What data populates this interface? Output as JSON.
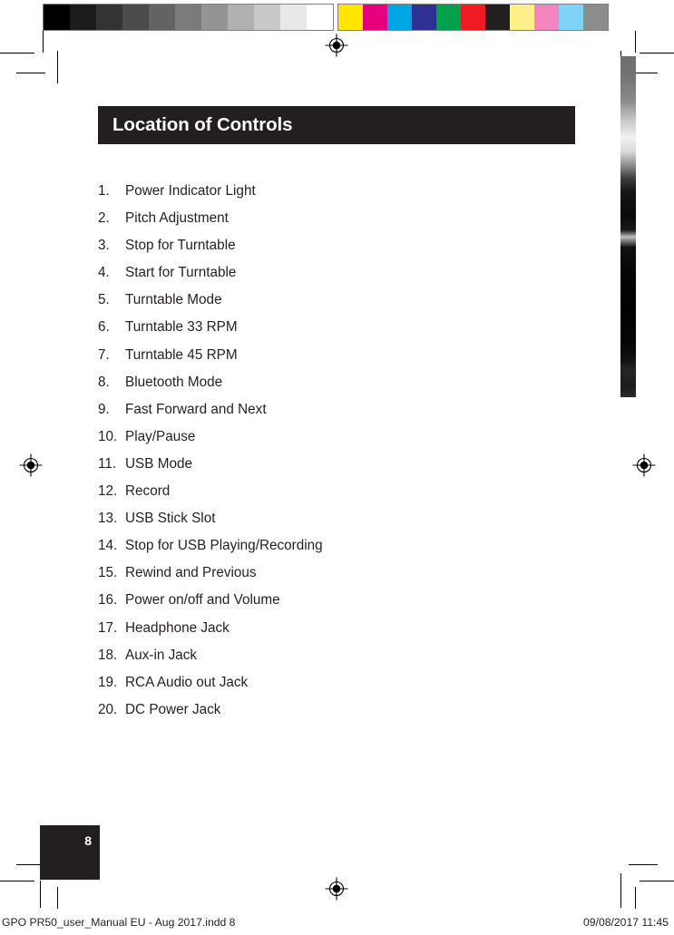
{
  "document": {
    "page_number": "8",
    "header_title": "Location of Controls",
    "header_bg": "#231f20",
    "text_color": "#231f20"
  },
  "controls_list": [
    {
      "number": "1.",
      "label": "Power Indicator Light"
    },
    {
      "number": "2.",
      "label": "Pitch Adjustment"
    },
    {
      "number": "3.",
      "label": "Stop for Turntable"
    },
    {
      "number": "4.",
      "label": "Start for Turntable"
    },
    {
      "number": "5.",
      "label": "Turntable Mode"
    },
    {
      "number": "6.",
      "label": "Turntable 33 RPM"
    },
    {
      "number": "7.",
      "label": "Turntable 45 RPM"
    },
    {
      "number": "8.",
      "label": "Bluetooth Mode"
    },
    {
      "number": "9.",
      "label": "Fast Forward and Next"
    },
    {
      "number": "10.",
      "label": "Play/Pause"
    },
    {
      "number": "11.",
      "label": "USB Mode"
    },
    {
      "number": "12.",
      "label": "Record"
    },
    {
      "number": "13.",
      "label": "USB Stick Slot"
    },
    {
      "number": "14.",
      "label": "Stop for USB Playing/Recording"
    },
    {
      "number": "15.",
      "label": "Rewind and Previous"
    },
    {
      "number": "16.",
      "label": "Power on/off and Volume"
    },
    {
      "number": "17.",
      "label": "Headphone Jack"
    },
    {
      "number": "18.",
      "label": "Aux-in Jack"
    },
    {
      "number": "19.",
      "label": "RCA Audio out Jack"
    },
    {
      "number": "20.",
      "label": "DC Power Jack"
    }
  ],
  "footer": {
    "file_slug": "GPO PR50_user_Manual EU - Aug 2017.indd   8",
    "timestamp": "09/08/2017   11:45"
  },
  "calibration": {
    "gray_bar": {
      "swatch_width": 29,
      "colors": [
        "#000000",
        "#1c1c1c",
        "#333333",
        "#4b4b4b",
        "#636363",
        "#7b7b7b",
        "#949494",
        "#b0b0b0",
        "#c9c9c9",
        "#e8e8e8",
        "#ffffff"
      ]
    },
    "color_bar": {
      "swatch_width": 27,
      "colors": [
        "#ffe600",
        "#e5007d",
        "#00a5e3",
        "#2e3192",
        "#00a14b",
        "#ed1c24",
        "#231f20",
        "#fdf08a",
        "#f386c0",
        "#7fd4f5",
        "#8c8c8c"
      ]
    }
  },
  "marks": {
    "registration_top": "registration-target",
    "registration_left": "registration-target",
    "registration_right": "registration-target",
    "registration_bottom": "registration-target"
  }
}
